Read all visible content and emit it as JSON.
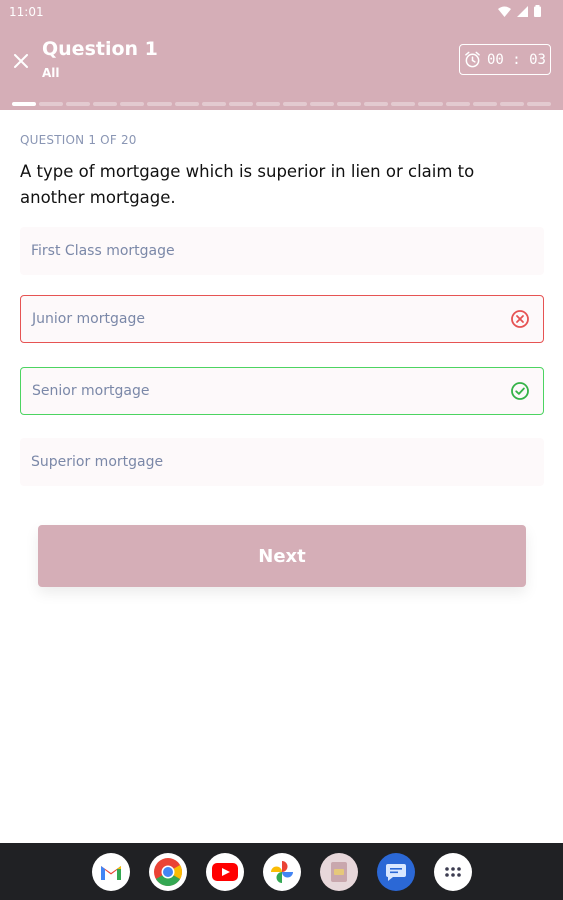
{
  "status": {
    "time": "11:01"
  },
  "header": {
    "title": "Question 1",
    "subtitle": "All",
    "timer": "00 : 03",
    "progress_total": 20,
    "progress_current": 1
  },
  "quiz": {
    "counter": "QUESTION 1 OF 20",
    "question": "A type of mortgage which is superior in lien or claim to another mortgage.",
    "options": [
      {
        "label": "First Class mortgage",
        "state": "neutral"
      },
      {
        "label": "Junior mortgage",
        "state": "wrong"
      },
      {
        "label": "Senior mortgage",
        "state": "correct"
      },
      {
        "label": "Superior mortgage",
        "state": "neutral"
      }
    ]
  },
  "actions": {
    "next_label": "Next"
  },
  "dock": {
    "apps": [
      "gmail-icon",
      "chrome-icon",
      "youtube-icon",
      "photos-icon",
      "files-icon",
      "messages-icon",
      "app-drawer-icon"
    ]
  },
  "colors": {
    "header_bg": "#d5aeb7",
    "wrong": "#e65353",
    "correct": "#4cd461",
    "option_text": "#7b88a8"
  }
}
